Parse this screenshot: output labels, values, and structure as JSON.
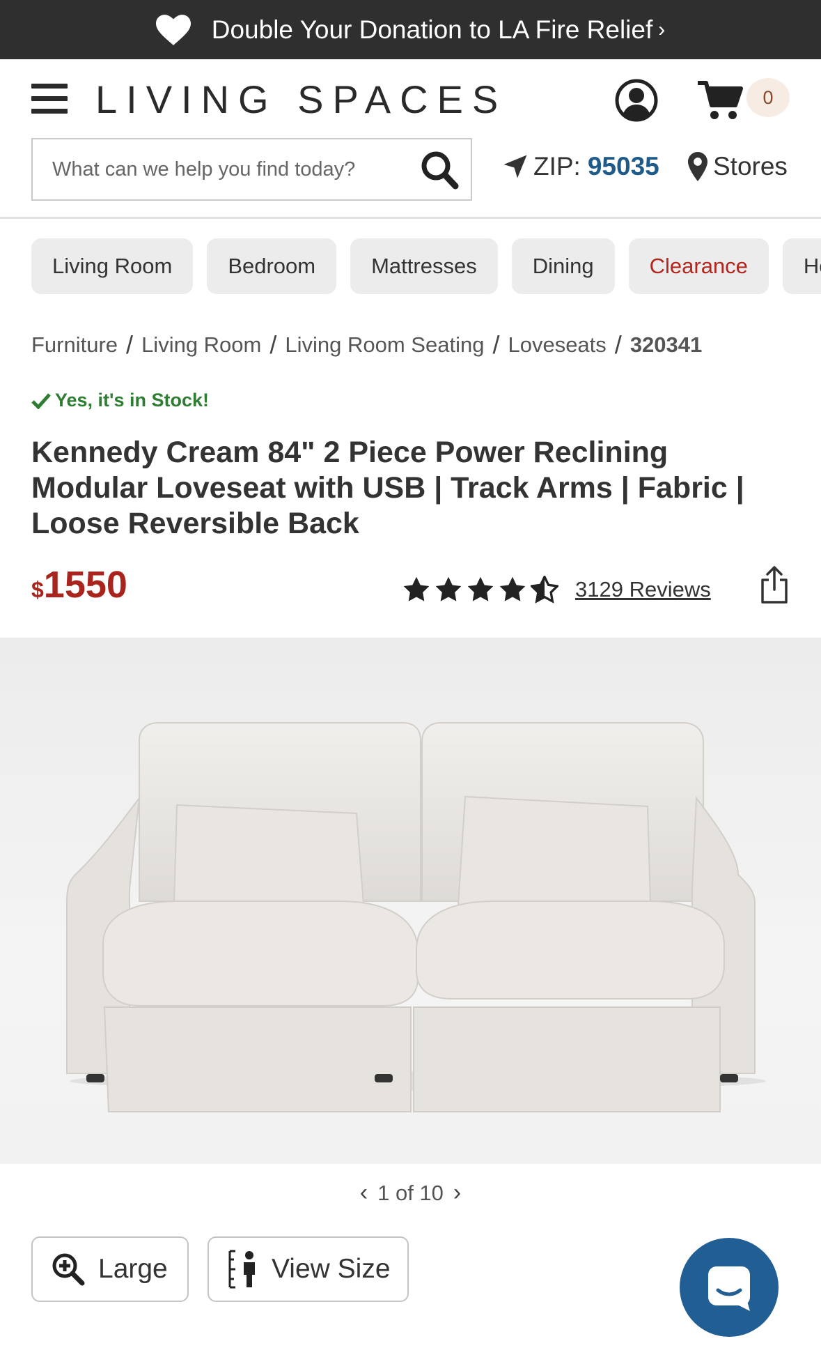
{
  "promo": {
    "text": "Double Your Donation to LA Fire Relief",
    "chevron": "›"
  },
  "header": {
    "logo": "LIVING SPACES",
    "cart_count": "0",
    "search_placeholder": "What can we help you find today?",
    "zip_label": "ZIP:",
    "zip_value": "95035",
    "stores_label": "Stores"
  },
  "categories": [
    {
      "label": "Living Room"
    },
    {
      "label": "Bedroom"
    },
    {
      "label": "Mattresses"
    },
    {
      "label": "Dining"
    },
    {
      "label": "Clearance"
    },
    {
      "label": "Ho"
    }
  ],
  "breadcrumb": {
    "items": [
      "Furniture",
      "Living Room",
      "Living Room Seating",
      "Loveseats"
    ],
    "separator": "/",
    "current": "320341"
  },
  "product": {
    "stock_text": "Yes, it's in Stock!",
    "title": "Kennedy Cream 84\" 2 Piece Power Reclining Modular Loveseat with USB | Track Arms | Fabric | Loose Reversible Back",
    "price_currency": "$",
    "price_amount": "1550",
    "rating": 4.5,
    "reviews_text": "3129 Reviews"
  },
  "gallery": {
    "pager_text": "1 of 10",
    "prev": "‹",
    "next": "›"
  },
  "actions": {
    "large_label": "Large",
    "view_size_label": "View Size"
  },
  "colors": {
    "promo_bg": "#2f2f2f",
    "price": "#a8241c",
    "stock": "#2e7d32",
    "zip": "#1f5b8a",
    "chat": "#215e93",
    "clearance": "#b3261e"
  },
  "icons": [
    "heart-icon",
    "hamburger-icon",
    "account-icon",
    "cart-icon",
    "search-icon",
    "location-arrow-icon",
    "map-pin-icon",
    "check-icon",
    "star-icon",
    "share-icon",
    "zoom-in-icon",
    "person-height-icon",
    "chat-icon"
  ]
}
